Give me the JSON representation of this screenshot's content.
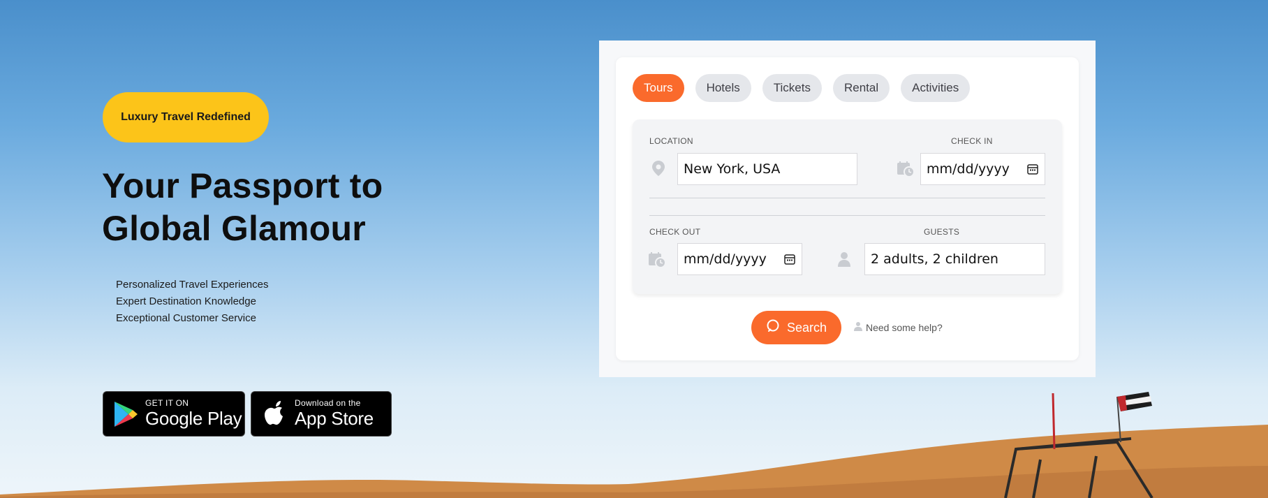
{
  "hero": {
    "badge": "Luxury Travel Redefined",
    "headline_line1": "Your Passport to",
    "headline_line2": "Global Glamour",
    "features": [
      "Personalized Travel Experiences",
      "Expert Destination Knowledge",
      "Exceptional Customer Service"
    ]
  },
  "stores": {
    "google_small": "GET IT ON",
    "google_big": "Google Play",
    "apple_small": "Download on the",
    "apple_big": "App Store"
  },
  "booking": {
    "tabs": [
      {
        "label": "Tours",
        "active": true
      },
      {
        "label": "Hotels",
        "active": false
      },
      {
        "label": "Tickets",
        "active": false
      },
      {
        "label": "Rental",
        "active": false
      },
      {
        "label": "Activities",
        "active": false
      }
    ],
    "location": {
      "label": "LOCATION",
      "value": "New York, USA",
      "icon": "map-pin-icon"
    },
    "check_in": {
      "label": "CHECK IN",
      "value": "mm/dd/yyyy",
      "icon": "calendar-clock-icon"
    },
    "check_out": {
      "label": "CHECK OUT",
      "value": "mm/dd/yyyy",
      "icon": "calendar-clock-icon"
    },
    "guests": {
      "label": "GUESTS",
      "value": "2 adults, 2 children",
      "icon": "user-icon"
    },
    "search_label": "Search",
    "help_label": "Need some help?"
  },
  "colors": {
    "accent": "#fa6a2c",
    "badge": "#fcc419",
    "sky_top": "#4a8fcb",
    "sand": "#d48e4a"
  }
}
